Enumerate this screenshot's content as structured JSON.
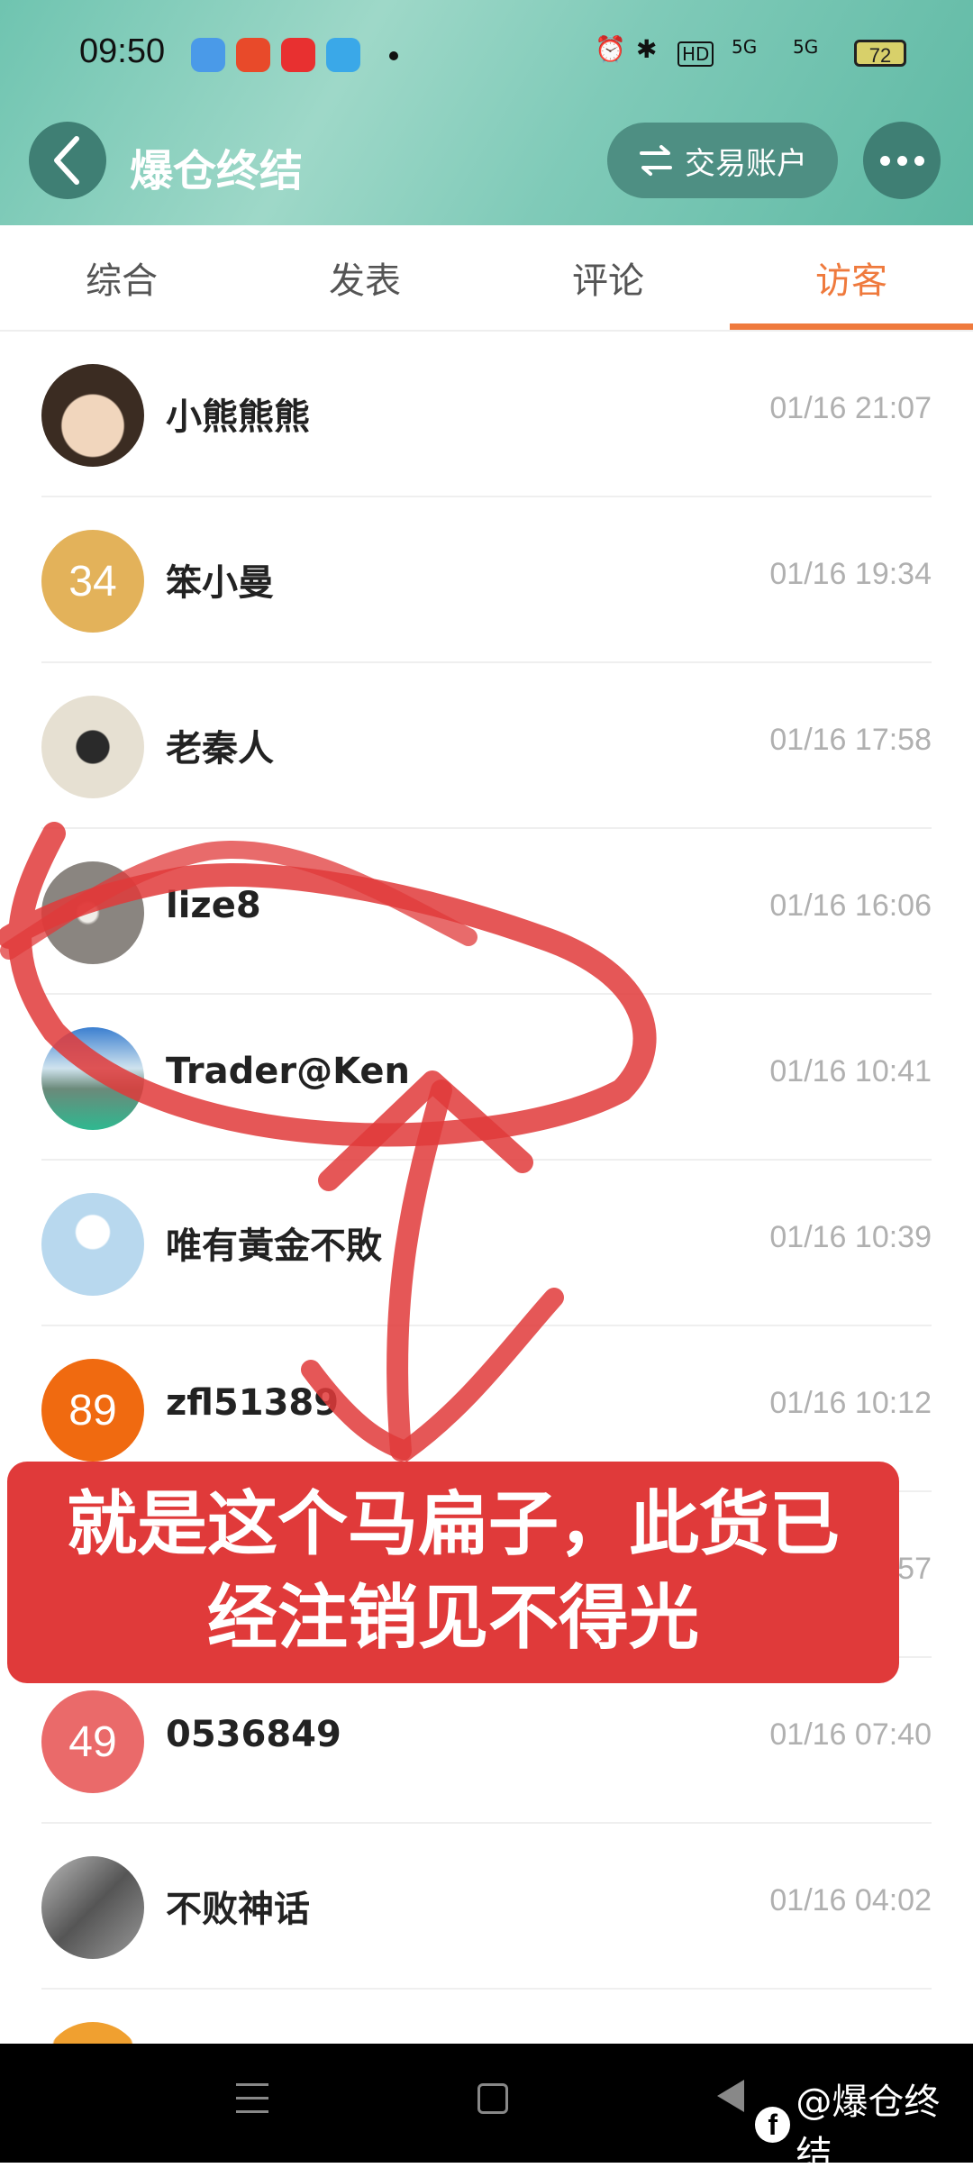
{
  "status_bar": {
    "time": "09:50",
    "network1": "5G",
    "network2": "5G",
    "hd": "HD",
    "battery": "72"
  },
  "header": {
    "title": "爆仓终结",
    "account_button": "交易账户",
    "accent": "#6fc4b0"
  },
  "tabs": [
    {
      "label": "综合",
      "active": false
    },
    {
      "label": "发表",
      "active": false
    },
    {
      "label": "评论",
      "active": false
    },
    {
      "label": "访客",
      "active": true
    }
  ],
  "visitors": [
    {
      "name": "小熊熊熊",
      "time": "01/16 21:07",
      "avatar_text": "",
      "avatar_color": "#c9a889"
    },
    {
      "name": "笨小曼",
      "time": "01/16 19:34",
      "avatar_text": "34",
      "avatar_color": "#e3b25a"
    },
    {
      "name": "老秦人",
      "time": "01/16 17:58",
      "avatar_text": "",
      "avatar_color": "#dcd6c8"
    },
    {
      "name": "lize8",
      "time": "01/16 16:06",
      "avatar_text": "",
      "avatar_color": "#8a8580"
    },
    {
      "name": "Trader@Ken",
      "time": "01/16 10:41",
      "avatar_text": "",
      "avatar_color": "#4aa0a0"
    },
    {
      "name": "唯有黃金不敗",
      "time": "01/16 10:39",
      "avatar_text": "",
      "avatar_color": "#b8d8ee"
    },
    {
      "name": "zfl51389",
      "time": "01/16 10:12",
      "avatar_text": "89",
      "avatar_color": "#f06a10"
    },
    {
      "name": "",
      "time": "57",
      "avatar_text": "",
      "avatar_color": "#ffffff"
    },
    {
      "name": "0536849",
      "time": "01/16 07:40",
      "avatar_text": "49",
      "avatar_color": "#ea6a6a"
    },
    {
      "name": "不败神话",
      "time": "01/16 04:02",
      "avatar_text": "",
      "avatar_color": "#777777"
    }
  ],
  "annotation": {
    "line1": "就是这个马扁子，此货已",
    "line2": "经注销见不得光"
  },
  "watermark": {
    "fb": "f",
    "text": "@爆仓终结"
  }
}
